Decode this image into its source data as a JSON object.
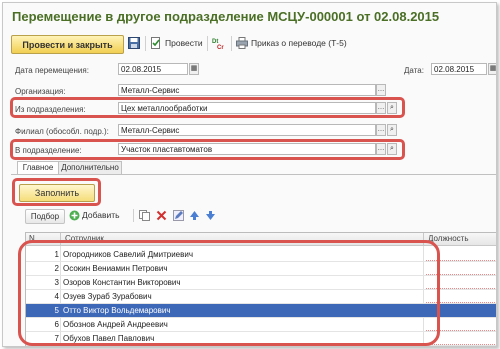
{
  "window": {
    "title": "Перемещение в другое подразделение МСЦУ-000001 от 02.08.2015"
  },
  "toolbar": {
    "post_close_label": "Провести и закрыть",
    "post_label": "Провести",
    "order_label": "Приказ о переводе (Т-5)"
  },
  "header": {
    "move_date_label": "Дата перемещения:",
    "move_date_value": "02.08.2015",
    "date_label": "Дата:",
    "date_value": "02.08.2015",
    "org_label": "Организация:",
    "org_value": "Металл-Сервис",
    "from_dept_label": "Из подразделения:",
    "from_dept_value": "Цех металлообработки",
    "branch_label": "Филиал (обособл. подр.):",
    "branch_value": "Металл-Сервис",
    "to_dept_label": "В подразделение:",
    "to_dept_value": "Участок пластавтоматов"
  },
  "tabs": [
    {
      "label": "Главное"
    },
    {
      "label": "Дополнительно"
    }
  ],
  "main": {
    "fill_label": "Заполнить",
    "select_label": "Подбор",
    "add_label": "Добавить"
  },
  "table": {
    "columns": [
      "N",
      "Сотрудник",
      "Должность"
    ],
    "rows": [
      {
        "n": "1",
        "employee": "Огородников Савелий Дмитриевич"
      },
      {
        "n": "2",
        "employee": "Осокин Вениамин Петрович"
      },
      {
        "n": "3",
        "employee": "Озоров Константин Викторович"
      },
      {
        "n": "4",
        "employee": "Озуев Зураб Зурабович"
      },
      {
        "n": "5",
        "employee": "Отто Виктор Вольдемарович"
      },
      {
        "n": "6",
        "employee": "Обознов Андрей Андреевич"
      },
      {
        "n": "7",
        "employee": "Обухов Павел Павлович"
      }
    ],
    "selected_row": 5
  },
  "colors": {
    "title": "#4a6f25",
    "highlight": "#d9534f",
    "selection": "#3d68b8",
    "primary_button": "#f2cf52"
  }
}
